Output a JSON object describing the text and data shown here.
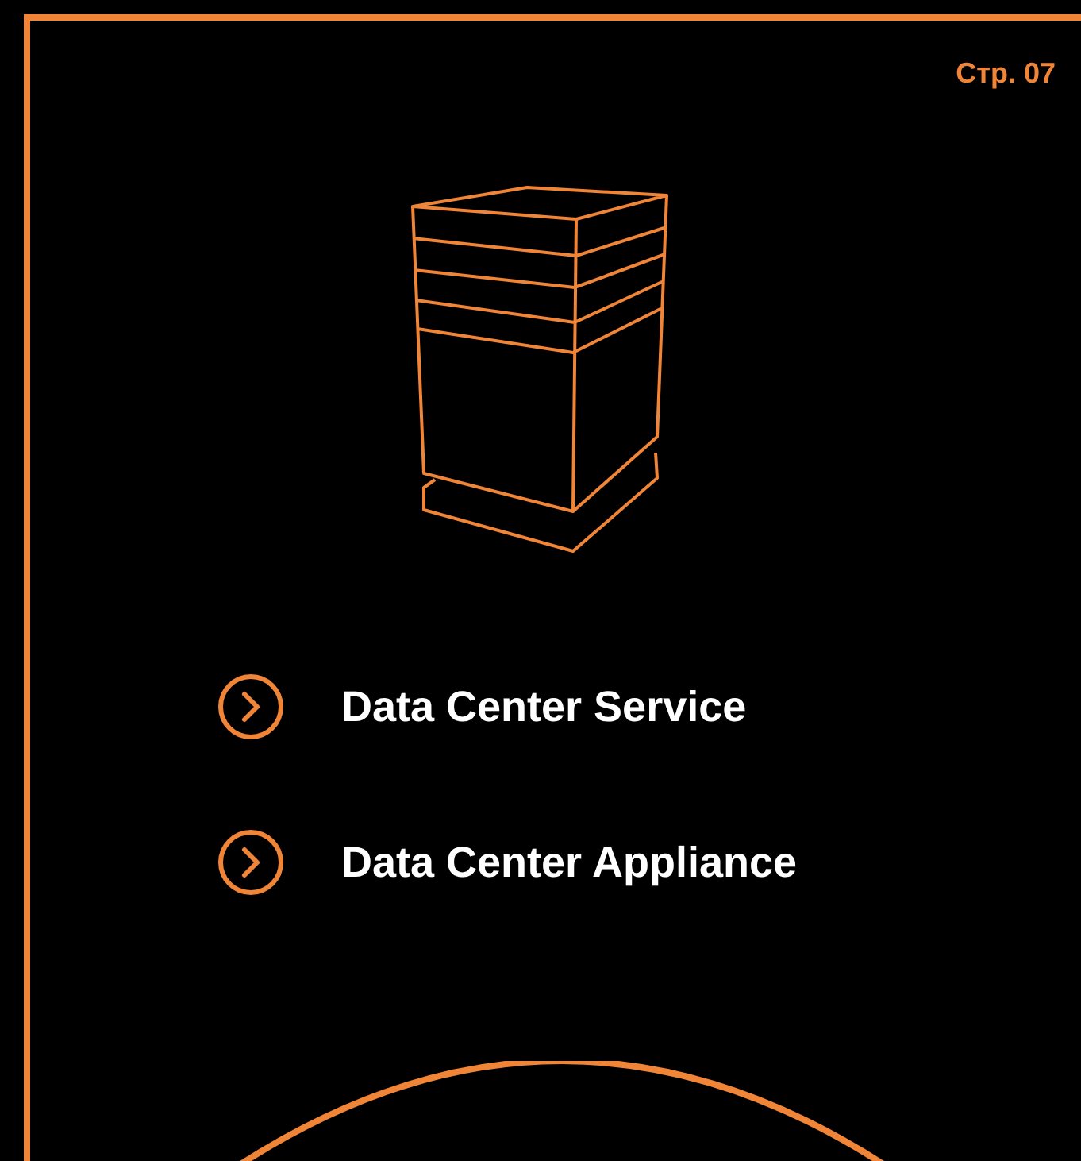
{
  "page_label": "Стр. 07",
  "links": [
    {
      "label": "Data Center Service"
    },
    {
      "label": "Data Center Appliance"
    }
  ]
}
